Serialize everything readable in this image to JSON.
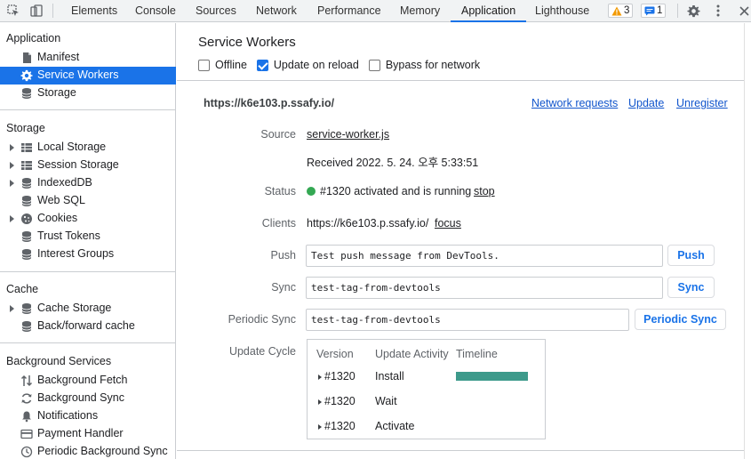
{
  "toolbar": {
    "tabs": [
      "Elements",
      "Console",
      "Sources",
      "Network",
      "Performance",
      "Memory",
      "Application",
      "Lighthouse"
    ],
    "active_tab": "Application",
    "warnings_count": "3",
    "messages_count": "1"
  },
  "sidebar": {
    "application": {
      "title": "Application",
      "items": [
        "Manifest",
        "Service Workers",
        "Storage"
      ],
      "selected": "Service Workers"
    },
    "storage": {
      "title": "Storage",
      "items": [
        "Local Storage",
        "Session Storage",
        "IndexedDB",
        "Web SQL",
        "Cookies",
        "Trust Tokens",
        "Interest Groups"
      ]
    },
    "cache": {
      "title": "Cache",
      "items": [
        "Cache Storage",
        "Back/forward cache"
      ]
    },
    "background_services": {
      "title": "Background Services",
      "items": [
        "Background Fetch",
        "Background Sync",
        "Notifications",
        "Payment Handler",
        "Periodic Background Sync"
      ]
    }
  },
  "main": {
    "title": "Service Workers",
    "options": {
      "offline": {
        "label": "Offline",
        "checked": false
      },
      "update_on_reload": {
        "label": "Update on reload",
        "checked": true
      },
      "bypass_for_network": {
        "label": "Bypass for network",
        "checked": false
      }
    },
    "worker": {
      "origin": "https://k6e103.p.ssafy.io/",
      "links": {
        "network_requests": "Network requests",
        "update": "Update",
        "unregister": "Unregister"
      },
      "source_label": "Source",
      "source_file": "service-worker.js",
      "received": "Received 2022. 5. 24. 오후 5:33:51",
      "status_label": "Status",
      "status_text": "#1320 activated and is running",
      "status_action": "stop",
      "status_color": "#34a853",
      "clients_label": "Clients",
      "clients_url": "https://k6e103.p.ssafy.io/",
      "clients_action": "focus",
      "push_label": "Push",
      "push_value": "Test push message from DevTools.",
      "push_button": "Push",
      "sync_label": "Sync",
      "sync_value": "test-tag-from-devtools",
      "sync_button": "Sync",
      "periodic_sync_label": "Periodic Sync",
      "periodic_sync_value": "test-tag-from-devtools",
      "periodic_sync_button": "Periodic Sync",
      "update_cycle_label": "Update Cycle",
      "update_cycle": {
        "headers": [
          "Version",
          "Update Activity",
          "Timeline"
        ],
        "rows": [
          {
            "version": "#1320",
            "activity": "Install"
          },
          {
            "version": "#1320",
            "activity": "Wait"
          },
          {
            "version": "#1320",
            "activity": "Activate"
          }
        ],
        "timeline_color": "#3d9a8b"
      }
    }
  }
}
